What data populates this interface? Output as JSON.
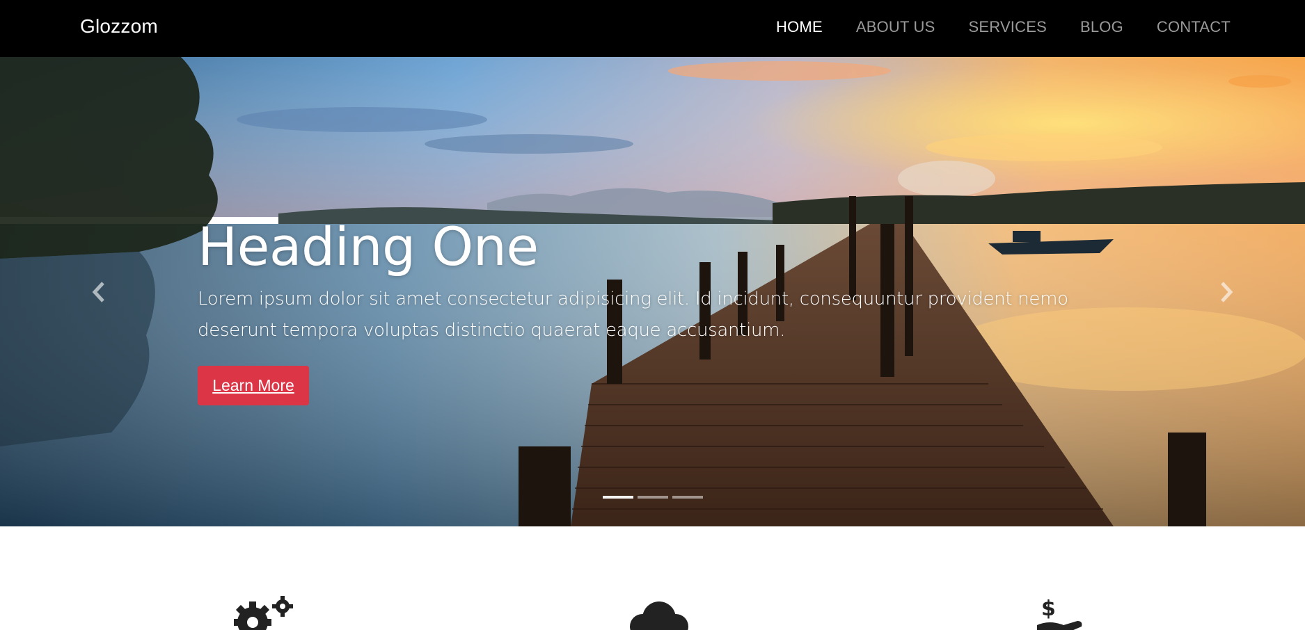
{
  "navbar": {
    "brand": "Glozzom",
    "links": [
      {
        "label": "HOME",
        "active": true
      },
      {
        "label": "ABOUT US",
        "active": false
      },
      {
        "label": "SERVICES",
        "active": false
      },
      {
        "label": "BLOG",
        "active": false
      },
      {
        "label": "CONTACT",
        "active": false
      }
    ]
  },
  "carousel": {
    "heading": "Heading One",
    "text": "Lorem ipsum dolor sit amet consectetur adipisicing elit. Id incidunt, consequuntur provident nemo deserunt tempora voluptas distinctio quaerat eaque accusantium.",
    "button_label": "Learn More",
    "slide_count": 3,
    "active_slide": 1
  },
  "features": {
    "icons": [
      "gears-icon",
      "cloud-icon",
      "hand-holding-usd-icon"
    ]
  },
  "colors": {
    "navbar_bg": "#000000",
    "nav_active": "#ffffff",
    "nav_inactive": "#9a9a9a",
    "button": "#dc3545"
  }
}
